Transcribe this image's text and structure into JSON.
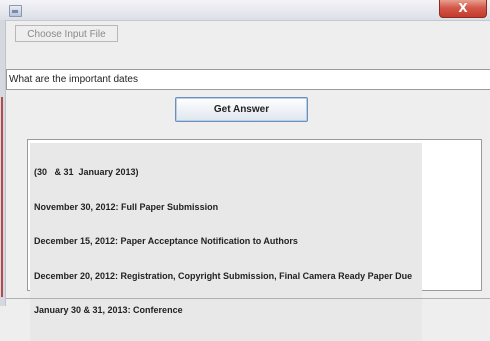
{
  "window": {
    "close_label": "X"
  },
  "toolbar": {
    "choose_input_label": "Choose Input File"
  },
  "query": {
    "value": "What are the important dates"
  },
  "actions": {
    "get_answer_label": "Get Answer"
  },
  "answer": {
    "lines": [
      "(30   & 31  January 2013)",
      "November 30, 2012: Full Paper Submission",
      "December 15, 2012: Paper Acceptance Notification to Authors",
      "December 20, 2012: Registration, Copyright Submission, Final Camera Ready Paper Due",
      "January 30 & 31, 2013: Conference"
    ]
  },
  "colors": {
    "close_button": "#c33a2b",
    "button_border": "#6d8fb8"
  }
}
